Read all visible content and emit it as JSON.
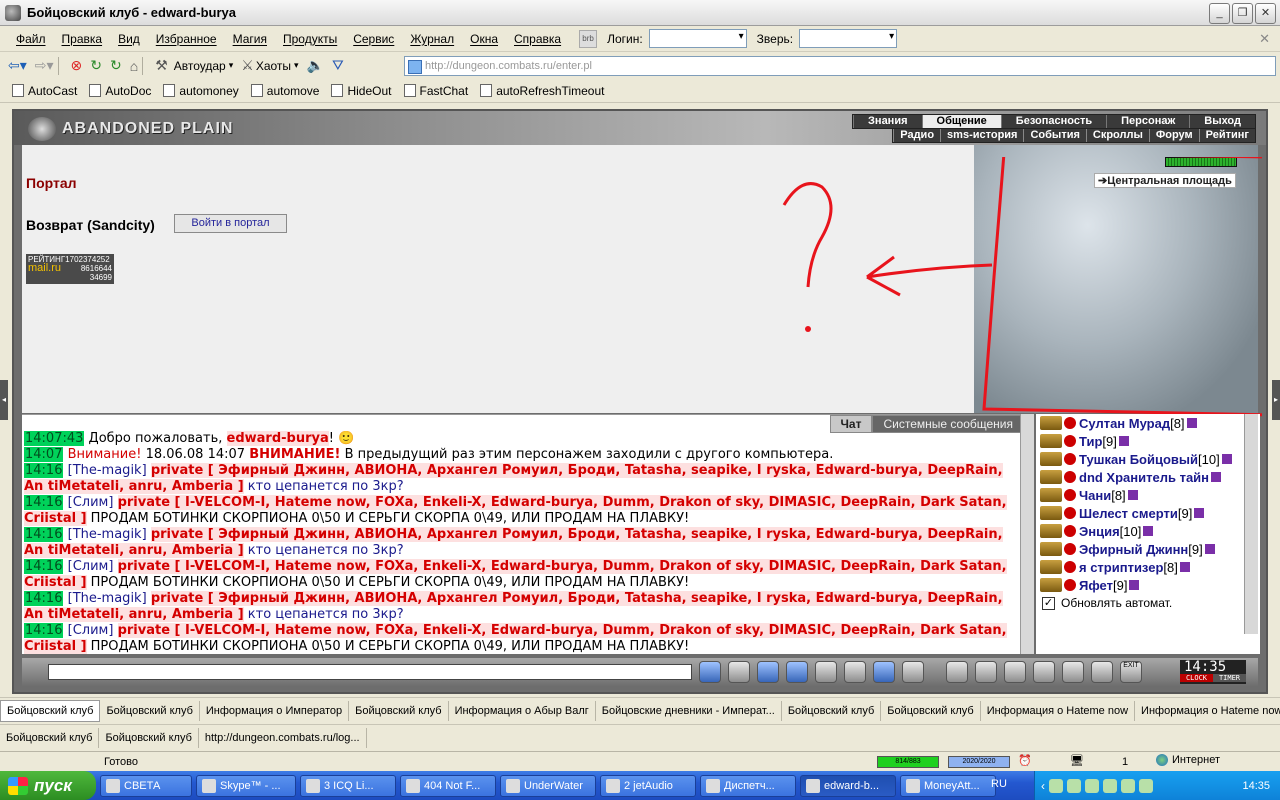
{
  "window": {
    "title": "Бойцовский клуб - edward-burya"
  },
  "menu": {
    "items": [
      "Файл",
      "Правка",
      "Вид",
      "Избранное",
      "Магия",
      "Продукты",
      "Сервис",
      "Журнал",
      "Окна",
      "Справка"
    ],
    "login_label": "Логин:",
    "beast_label": "Зверь:"
  },
  "nav": {
    "autoudar": "Автоудар",
    "haoty": "Хаоты",
    "url": "http://dungeon.combats.ru/enter.pl"
  },
  "links": [
    "AutoCast",
    "AutoDoc",
    "automoney",
    "automove",
    "HideOut",
    "FastChat",
    "autoRefreshTimeout"
  ],
  "game": {
    "logo": "ABANDONED PLAIN",
    "top_nav": [
      "Знания",
      "Общение",
      "Безопасность",
      "Персонаж",
      "Выход"
    ],
    "sub_nav": [
      "Радио",
      "sms-история",
      "События",
      "Скроллы",
      "Форум",
      "Рейтинг"
    ],
    "portal_title": "Портал",
    "return_label": "Возврат (Sandcity)",
    "portal_button": "Войти в портал",
    "counter": {
      "label": "РЕЙТИНГ",
      "num1": "1702374252",
      "brand": "mail.ru",
      "num2": "8616644",
      "num3": "34699"
    },
    "location_label": "Центральная площадь",
    "annotation_color": "#e8141c"
  },
  "chat": {
    "tabs": [
      "Чат",
      "Системные сообщения"
    ],
    "welcome": {
      "time": "14:07:43",
      "text": "Добро пожаловать, ",
      "user": "edward-burya",
      "tail": "!"
    },
    "warning": {
      "time": "14:07",
      "label": "Внимание!",
      "date": "18.06.08 14:07",
      "label2": "ВНИМАНИЕ!",
      "text": "В предыдущий раз этим персонажем заходили с другого компьютера."
    },
    "messages": [
      {
        "time": "14:16",
        "nick": "The-magik",
        "priv": "private [ Эфирный Джинн, АВИОНА, Архангел Ромуил, Броди, Tatasha, seapike, I ryska, Edward-burya, DeepRain, An tiMetateli, anru, Amberia ]",
        "text": "кто цепанется по 3кр?",
        "text_color": "blue"
      },
      {
        "time": "14:16",
        "nick": "Слим",
        "priv": "private [ I-VELCOM-I, Hateme now, FOXa, Enkeli-X, Edward-burya, Dumm, Drakon of sky, DIMASIC, DeepRain, Dark Satan, Criistal ]",
        "text": "ПРОДАМ БОТИНКИ СКОРПИОНА 0\\50 И СЕРЬГИ СКОРПА 0\\49, ИЛИ ПРОДАМ НА ПЛАВКУ!",
        "text_color": "plain"
      },
      {
        "time": "14:16",
        "nick": "The-magik",
        "priv": "private [ Эфирный Джинн, АВИОНА, Архангел Ромуил, Броди, Tatasha, seapike, I ryska, Edward-burya, DeepRain, An tiMetateli, anru, Amberia ]",
        "text": "кто цепанется по 3кр?",
        "text_color": "blue"
      },
      {
        "time": "14:16",
        "nick": "Слим",
        "priv": "private [ I-VELCOM-I, Hateme now, FOXa, Enkeli-X, Edward-burya, Dumm, Drakon of sky, DIMASIC, DeepRain, Dark Satan, Criistal ]",
        "text": "ПРОДАМ БОТИНКИ СКОРПИОНА 0\\50 И СЕРЬГИ СКОРПА 0\\49, ИЛИ ПРОДАМ НА ПЛАВКУ!",
        "text_color": "plain"
      },
      {
        "time": "14:16",
        "nick": "The-magik",
        "priv": "private [ Эфирный Джинн, АВИОНА, Архангел Ромуил, Броди, Tatasha, seapike, I ryska, Edward-burya, DeepRain, An tiMetateli, anru, Amberia ]",
        "text": "кто цепанется по 3кр?",
        "text_color": "blue"
      },
      {
        "time": "14:16",
        "nick": "Слим",
        "priv": "private [ I-VELCOM-I, Hateme now, FOXa, Enkeli-X, Edward-burya, Dumm, Drakon of sky, DIMASIC, DeepRain, Dark Satan, Criistal ]",
        "text": "ПРОДАМ БОТИНКИ СКОРПИОНА 0\\50 И СЕРЬГИ СКОРПА 0\\49, ИЛИ ПРОДАМ НА ПЛАВКУ!",
        "text_color": "plain"
      }
    ]
  },
  "online": {
    "users": [
      {
        "name": "Султан Мурад",
        "level": "[8]"
      },
      {
        "name": "Тир",
        "level": "[9]"
      },
      {
        "name": "Тушкан Бойцовый",
        "level": "[10]"
      },
      {
        "name": "dnd Хранитель тайн",
        "level": ""
      },
      {
        "name": "Чани",
        "level": "[8]"
      },
      {
        "name": "Шелест смерти",
        "level": "[9]"
      },
      {
        "name": "Энция",
        "level": "[10]"
      },
      {
        "name": "Эфирный Джинн",
        "level": "[9]"
      },
      {
        "name": "я стриптизер",
        "level": "[8]"
      },
      {
        "name": "Яфет",
        "level": "[9]"
      }
    ],
    "auto_update": "Обновлять автомат."
  },
  "clock": {
    "time": "14:35",
    "clock_label": "CLOCK",
    "timer_label": "TIMER",
    "exit": "EXIT"
  },
  "tabs_row1": [
    "Бойцовский клуб",
    "Бойцовский клуб",
    "Информация о Император",
    "Бойцовский клуб",
    "Информация о Абыр Валг",
    "Бойцовские дневники - Императ...",
    "Бойцовский клуб",
    "Бойцовский клуб",
    "Информация о Hateme now",
    "Информация о Hateme now"
  ],
  "tabs_row2": [
    "Бойцовский клуб",
    "Бойцовский клуб",
    "http://dungeon.combats.ru/log..."
  ],
  "status": {
    "text": "Готово",
    "hp": "814/883",
    "mana": "2020/2020",
    "zone_num": "1",
    "zone": "Интернет"
  },
  "taskbar": {
    "start": "пуск",
    "tasks": [
      "СВЕТА",
      "Skype™ - ...",
      "3 ICQ Li...",
      "404 Not F...",
      "UnderWater",
      "2 jetAudio",
      "Диспетч...",
      "edward-b...",
      "MoneyAtt..."
    ],
    "lang": "RU",
    "time": "14:35"
  }
}
